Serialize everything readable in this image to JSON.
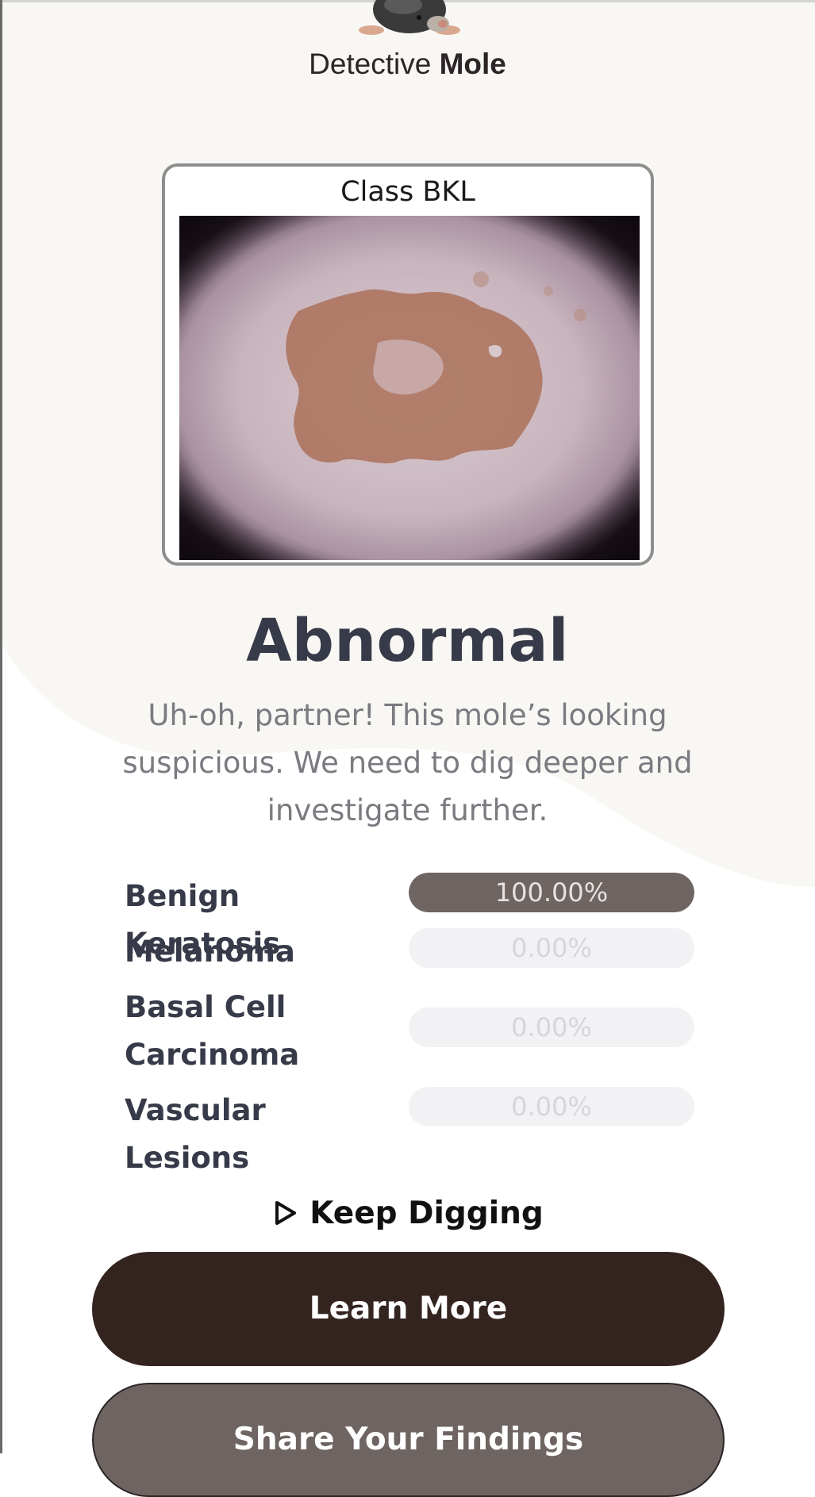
{
  "brand": {
    "prefix": "Detective",
    "name": "Mole"
  },
  "image_card": {
    "title": "Class BKL"
  },
  "result": {
    "title": "Abnormal",
    "description": "Uh-oh, partner! This mole’s looking suspicious. We need to dig deeper and investigate further."
  },
  "probabilities": [
    {
      "label": "Benign Keratosis",
      "value_text": "100.00%",
      "value": 100
    },
    {
      "label": "Melanoma",
      "value_text": "0.00%",
      "value": 0
    },
    {
      "label": "Basal Cell Carcinoma",
      "value_text": "0.00%",
      "value": 0
    },
    {
      "label": "Vascular Lesions",
      "value_text": "0.00%",
      "value": 0
    }
  ],
  "actions": {
    "keep_digging": "Keep Digging",
    "learn_more": "Learn More",
    "share": "Share Your Findings"
  },
  "icons": {
    "logo": "mole-mascot-icon",
    "keep_digging": "play-outline-icon"
  },
  "colors": {
    "background_blob": "#f8f7f4",
    "primary_button": "#34241f",
    "secondary_button": "#6e6461",
    "bar_fill": "#6e6461",
    "bar_track": "#f2f2f4",
    "heading": "#373a48"
  }
}
